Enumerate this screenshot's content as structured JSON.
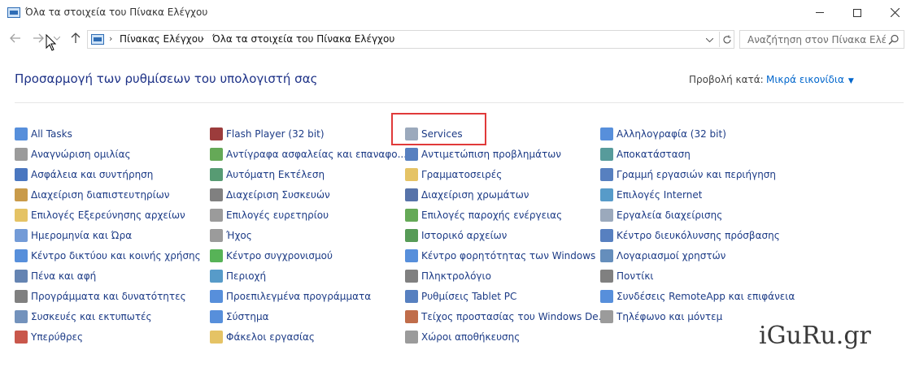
{
  "window": {
    "title": "Όλα τα στοιχεία του Πίνακα Ελέγχου",
    "min_label": "—",
    "max_label": "☐",
    "close_label": "✕"
  },
  "nav": {
    "back": "←",
    "forward": "→",
    "history": "⌄",
    "up": "↑"
  },
  "address": {
    "crumbs": [
      "Πίνακας Ελέγχου",
      "Όλα τα στοιχεία του Πίνακα Ελέγχου"
    ],
    "separator": "›",
    "dropdown": "⌄",
    "refresh": "↻"
  },
  "search": {
    "placeholder": "Αναζήτηση στον Πίνακα Ελέγ..."
  },
  "header": {
    "title": "Προσαρμογή των ρυθμίσεων του υπολογιστή σας",
    "view_by_label": "Προβολή κατά:",
    "view_by_value": "Μικρά εικονίδια",
    "view_by_arrow": "▼"
  },
  "columns": [
    [
      {
        "label": "All Tasks",
        "icon": "all-tasks-icon",
        "color": "#3a7bd5"
      },
      {
        "label": "Αναγνώριση ομιλίας",
        "icon": "microphone-icon",
        "color": "#8a8a8a"
      },
      {
        "label": "Ασφάλεια και συντήρηση",
        "icon": "flag-icon",
        "color": "#2a5fb5"
      },
      {
        "label": "Διαχείριση διαπιστευτηρίων",
        "icon": "credential-icon",
        "color": "#c08a2a"
      },
      {
        "label": "Επιλογές Εξερεύνησης αρχείων",
        "icon": "folder-options-icon",
        "color": "#e0b84a"
      },
      {
        "label": "Ημερομηνία και Ώρα",
        "icon": "date-time-icon",
        "color": "#5a8ad0"
      },
      {
        "label": "Κέντρο δικτύου και κοινής χρήσης",
        "icon": "network-icon",
        "color": "#3a7bd5"
      },
      {
        "label": "Πένα και αφή",
        "icon": "pen-icon",
        "color": "#4a6fa5"
      },
      {
        "label": "Προγράμματα και δυνατότητες",
        "icon": "programs-icon",
        "color": "#6a6a6a"
      },
      {
        "label": "Συσκευές και εκτυπωτές",
        "icon": "printer-icon",
        "color": "#5a7fb0"
      },
      {
        "label": "Υπερύθρες",
        "icon": "infrared-icon",
        "color": "#c0392b"
      }
    ],
    [
      {
        "label": "Flash Player (32 bit)",
        "icon": "flash-player-icon",
        "color": "#8b1a1a"
      },
      {
        "label": "Αντίγραφα ασφαλείας και επαναφο...",
        "icon": "backup-icon",
        "color": "#4a9a3a"
      },
      {
        "label": "Αυτόματη Εκτέλεση",
        "icon": "autoplay-icon",
        "color": "#3a8a5a"
      },
      {
        "label": "Διαχείριση Συσκευών",
        "icon": "device-manager-icon",
        "color": "#6a6a6a"
      },
      {
        "label": "Επιλογές ευρετηρίου",
        "icon": "indexing-icon",
        "color": "#8a8a8a"
      },
      {
        "label": "Ήχος",
        "icon": "sound-icon",
        "color": "#8a8a8a"
      },
      {
        "label": "Κέντρο συγχρονισμού",
        "icon": "sync-icon",
        "color": "#3aa63a"
      },
      {
        "label": "Περιοχή",
        "icon": "region-icon",
        "color": "#3a8ac0"
      },
      {
        "label": "Προεπιλεγμένα προγράμματα",
        "icon": "default-programs-icon",
        "color": "#3a7bd5"
      },
      {
        "label": "Σύστημα",
        "icon": "system-icon",
        "color": "#3a7bd5"
      },
      {
        "label": "Φάκελοι εργασίας",
        "icon": "work-folders-icon",
        "color": "#e0b84a"
      }
    ],
    [
      {
        "label": "Services",
        "icon": "services-icon",
        "color": "#8a9ab0"
      },
      {
        "label": "Αντιμετώπιση προβλημάτων",
        "icon": "troubleshoot-icon",
        "color": "#3a6ab5"
      },
      {
        "label": "Γραμματοσειρές",
        "icon": "fonts-icon",
        "color": "#e0b84a"
      },
      {
        "label": "Διαχείριση χρωμάτων",
        "icon": "color-management-icon",
        "color": "#3a5a9a"
      },
      {
        "label": "Επιλογές παροχής ενέργειας",
        "icon": "power-icon",
        "color": "#4a9a3a"
      },
      {
        "label": "Ιστορικό αρχείων",
        "icon": "file-history-icon",
        "color": "#3a8a3a"
      },
      {
        "label": "Κέντρο φορητότητας των Windows",
        "icon": "mobility-center-icon",
        "color": "#3a7bd5"
      },
      {
        "label": "Πληκτρολόγιο",
        "icon": "keyboard-icon",
        "color": "#6a6a6a"
      },
      {
        "label": "Ρυθμίσεις Tablet PC",
        "icon": "tablet-icon",
        "color": "#3a6ab5"
      },
      {
        "label": "Τείχος προστασίας του Windows De...",
        "icon": "firewall-icon",
        "color": "#b5532a"
      },
      {
        "label": "Χώροι αποθήκευσης",
        "icon": "storage-spaces-icon",
        "color": "#8a8a8a"
      }
    ],
    [
      {
        "label": "Αλληλογραφία (32 bit)",
        "icon": "mail-icon",
        "color": "#3a7bd5"
      },
      {
        "label": "Αποκατάσταση",
        "icon": "recovery-icon",
        "color": "#3a8a8a"
      },
      {
        "label": "Γραμμή εργασιών και περιήγηση",
        "icon": "taskbar-icon",
        "color": "#3a6ab5"
      },
      {
        "label": "Επιλογές Internet",
        "icon": "internet-options-icon",
        "color": "#3a8ac0"
      },
      {
        "label": "Εργαλεία διαχείρισης",
        "icon": "admin-tools-icon",
        "color": "#8a9ab0"
      },
      {
        "label": "Κέντρο διευκόλυνσης πρόσβασης",
        "icon": "ease-of-access-icon",
        "color": "#3a6ab5"
      },
      {
        "label": "Λογαριασμοί χρηστών",
        "icon": "user-accounts-icon",
        "color": "#4a7ab0"
      },
      {
        "label": "Ποντίκι",
        "icon": "mouse-icon",
        "color": "#6a6a6a"
      },
      {
        "label": "Συνδέσεις RemoteApp και επιφάνεια...",
        "icon": "remoteapp-icon",
        "color": "#3a7bd5"
      },
      {
        "label": "Τηλέφωνο και μόντεμ",
        "icon": "phone-modem-icon",
        "color": "#8a8a8a"
      }
    ]
  ],
  "watermark": "iGuRu.gr",
  "colors": {
    "highlight": "#e03a3a",
    "link": "#1c3b86",
    "heading": "#1e3287",
    "accent": "#0066cc"
  }
}
